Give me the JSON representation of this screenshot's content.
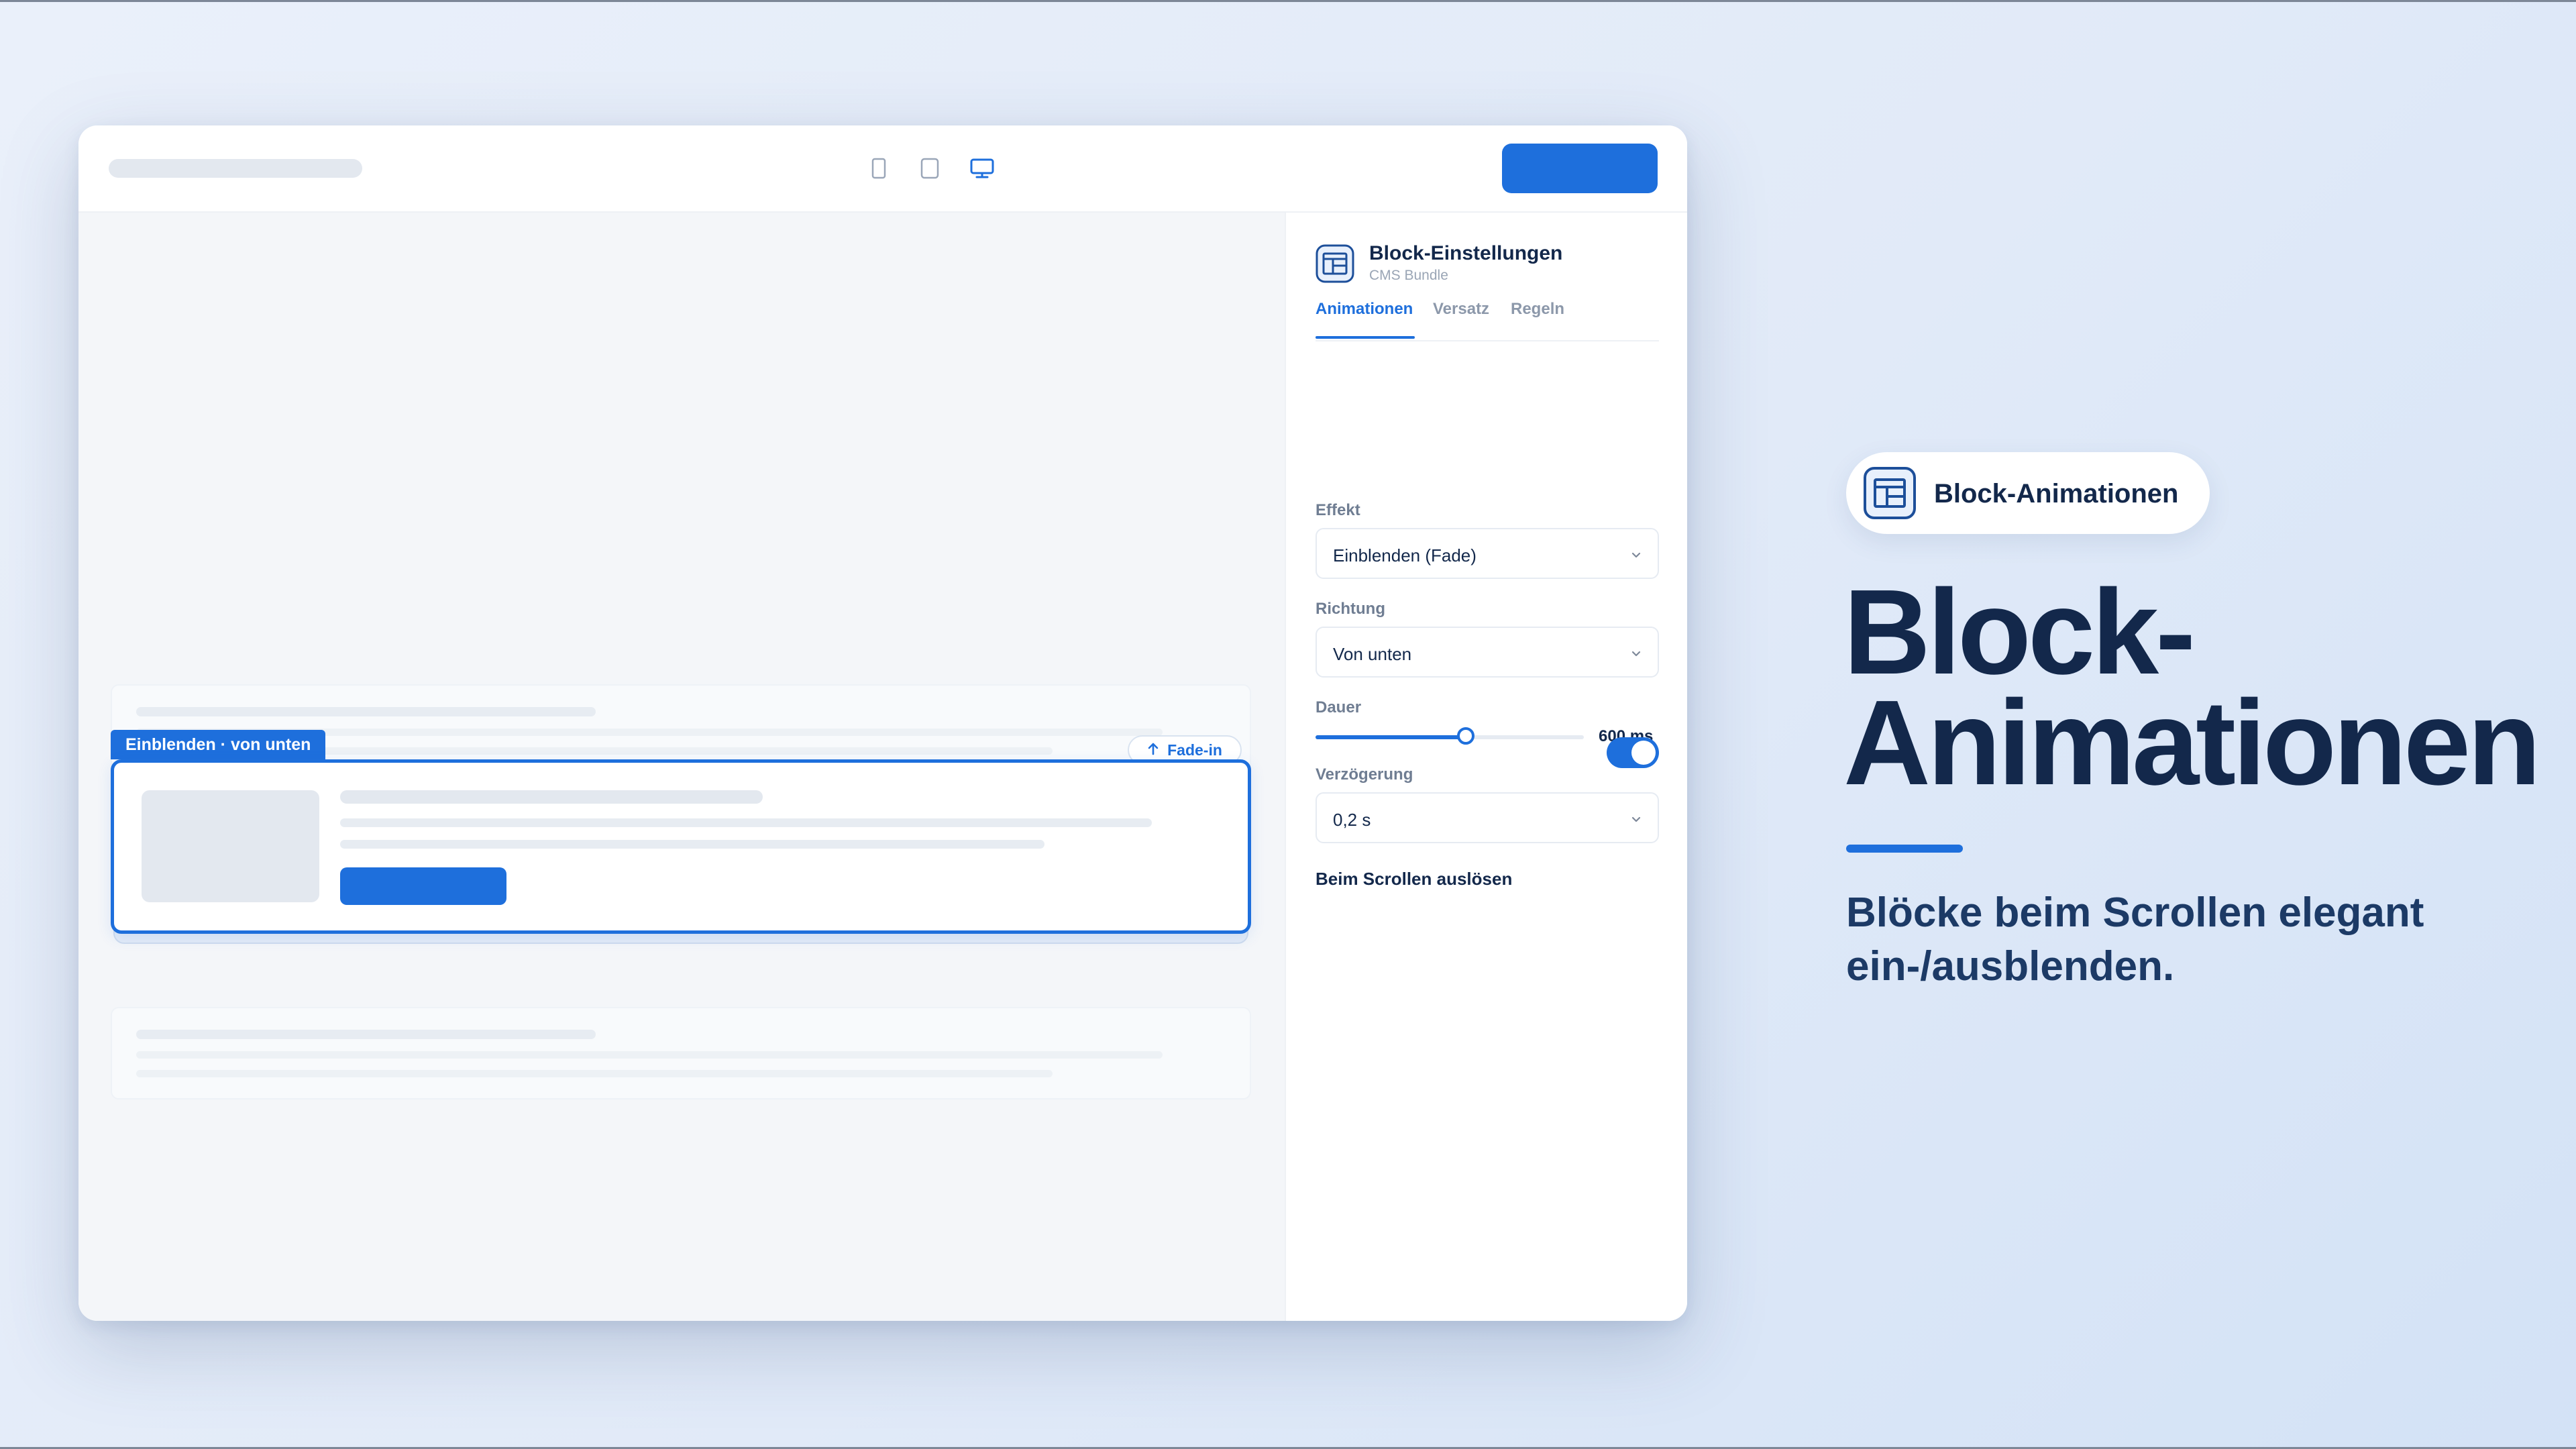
{
  "canvas": {
    "block_tag": "Einblenden · von unten",
    "fade_chip": "Fade-in"
  },
  "panel": {
    "title": "Block-Einstellungen",
    "subtitle": "CMS Bundle",
    "tabs": [
      {
        "label": "Animationen",
        "active": true
      },
      {
        "label": "Versatz",
        "active": false
      },
      {
        "label": "Regeln",
        "active": false
      }
    ],
    "effect": {
      "label": "Effekt",
      "value": "Einblenden (Fade)"
    },
    "direction": {
      "label": "Richtung",
      "value": "Von unten"
    },
    "duration": {
      "label": "Dauer",
      "value_text": "600 ms",
      "slider_fraction": 0.56
    },
    "delay": {
      "label": "Verzögerung",
      "value": "0,2 s"
    },
    "scroll_trigger": {
      "label": "Beim Scrollen auslösen",
      "enabled": true
    }
  },
  "hero": {
    "badge": "Block-Animationen",
    "headline_line1": "Block-",
    "headline_line2": "Animationen",
    "subline_line1": "Blöcke beim Scrollen elegant",
    "subline_line2": "ein-/ausblenden."
  },
  "colors": {
    "accent": "#1e6fdc",
    "navy": "#13284b"
  },
  "icons": [
    "mobile-device-icon",
    "tablet-device-icon",
    "desktop-device-icon",
    "layout-block-icon",
    "chevron-down-icon",
    "arrow-up-icon"
  ]
}
